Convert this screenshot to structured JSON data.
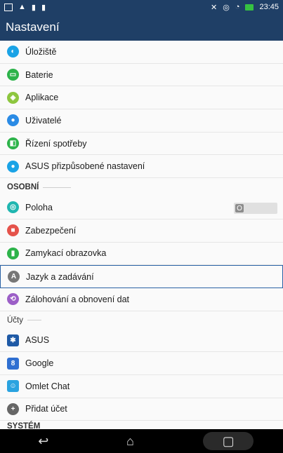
{
  "status": {
    "time": "23:45"
  },
  "appbar": {
    "title": "Nastavení"
  },
  "items": [
    {
      "label": "Úložiště",
      "icon": "storage-icon",
      "color": "#1aa3e6"
    },
    {
      "label": "Baterie",
      "icon": "battery-icon",
      "color": "#2db34a"
    },
    {
      "label": "Aplikace",
      "icon": "apps-icon",
      "color": "#8dc63f"
    },
    {
      "label": "Uživatelé",
      "icon": "users-icon",
      "color": "#2b8be5"
    },
    {
      "label": "Řízení spotřeby",
      "icon": "power-management-icon",
      "color": "#2db34a"
    },
    {
      "label": "ASUS přizpůsobené nastavení",
      "icon": "asus-customized-icon",
      "color": "#1aa3e6"
    }
  ],
  "section_personal": "OSOBNÍ",
  "personal": [
    {
      "label": "Poloha",
      "icon": "location-icon",
      "color": "#20b6b0",
      "toggle": "O"
    },
    {
      "label": "Zabezpečení",
      "icon": "security-icon",
      "color": "#e5534b"
    },
    {
      "label": "Zamykací obrazovka",
      "icon": "lock-screen-icon",
      "color": "#2db34a"
    },
    {
      "label": "Jazyk a zadávání",
      "icon": "language-icon",
      "color": "#777777"
    },
    {
      "label": "Zálohování a obnovení dat",
      "icon": "backup-icon",
      "color": "#9c5fc7"
    }
  ],
  "section_accounts": "Účty",
  "accounts": [
    {
      "label": "ASUS",
      "icon": "asus-account-icon",
      "color": "#1f5aa6"
    },
    {
      "label": "Google",
      "icon": "google-icon",
      "color": "#2f6fd1"
    },
    {
      "label": "Omlet Chat",
      "icon": "omlet-chat-icon",
      "color": "#2aa3e0"
    },
    {
      "label": "Přidat účet",
      "icon": "add-account-icon",
      "color": "#666666"
    }
  ],
  "section_system": "SYSTÉM"
}
